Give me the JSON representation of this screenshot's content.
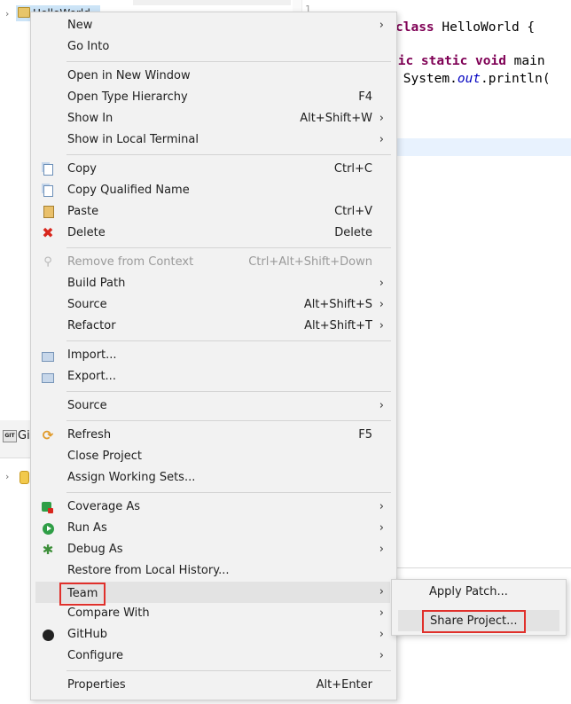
{
  "explorer": {
    "project_label": "HelloWorld"
  },
  "editor": {
    "line_number": "1",
    "code": {
      "line1_kw": "class",
      "line1_rest": " HelloWorld {",
      "line2_kw": "lic static void",
      "line2_rest": " main",
      "line3_pre": " System.",
      "line3_field": "out",
      "line3_post": ".println("
    }
  },
  "git_panel": {
    "tab_label": "Gi"
  },
  "context_menu": {
    "items": [
      {
        "label": "New",
        "shortcut": "",
        "submenu": true
      },
      {
        "label": "Go Into",
        "shortcut": ""
      },
      {
        "label": "Open in New Window",
        "shortcut": ""
      },
      {
        "label": "Open Type Hierarchy",
        "shortcut": "F4"
      },
      {
        "label": "Show In",
        "shortcut": "Alt+Shift+W",
        "submenu": true
      },
      {
        "label": "Show in Local Terminal",
        "shortcut": "",
        "submenu": true
      },
      {
        "label": "Copy",
        "shortcut": "Ctrl+C",
        "icon": "copy-icon"
      },
      {
        "label": "Copy Qualified Name",
        "shortcut": "",
        "icon": "copy-qualified-name-icon"
      },
      {
        "label": "Paste",
        "shortcut": "Ctrl+V",
        "icon": "paste-icon"
      },
      {
        "label": "Delete",
        "shortcut": "Delete",
        "icon": "delete-icon"
      },
      {
        "label": "Remove from Context",
        "shortcut": "Ctrl+Alt+Shift+Down",
        "disabled": true,
        "icon": "remove-context-icon"
      },
      {
        "label": "Build Path",
        "shortcut": "",
        "submenu": true
      },
      {
        "label": "Source",
        "shortcut": "Alt+Shift+S",
        "submenu": true
      },
      {
        "label": "Refactor",
        "shortcut": "Alt+Shift+T",
        "submenu": true
      },
      {
        "label": "Import...",
        "shortcut": "",
        "icon": "import-icon"
      },
      {
        "label": "Export...",
        "shortcut": "",
        "icon": "export-icon"
      },
      {
        "label": "Source",
        "shortcut": "",
        "submenu": true
      },
      {
        "label": "Refresh",
        "shortcut": "F5",
        "icon": "refresh-icon"
      },
      {
        "label": "Close Project",
        "shortcut": ""
      },
      {
        "label": "Assign Working Sets...",
        "shortcut": ""
      },
      {
        "label": "Coverage As",
        "shortcut": "",
        "submenu": true,
        "icon": "coverage-icon"
      },
      {
        "label": "Run As",
        "shortcut": "",
        "submenu": true,
        "icon": "run-icon"
      },
      {
        "label": "Debug As",
        "shortcut": "",
        "submenu": true,
        "icon": "debug-icon"
      },
      {
        "label": "Restore from Local History...",
        "shortcut": ""
      },
      {
        "label": "Team",
        "shortcut": "",
        "submenu": true,
        "highlighted": true
      },
      {
        "label": "Compare With",
        "shortcut": "",
        "submenu": true
      },
      {
        "label": "GitHub",
        "shortcut": "",
        "submenu": true,
        "icon": "github-icon"
      },
      {
        "label": "Configure",
        "shortcut": "",
        "submenu": true
      },
      {
        "label": "Properties",
        "shortcut": "Alt+Enter"
      }
    ],
    "arrow_glyph": "›"
  },
  "team_submenu": {
    "items": [
      {
        "label": "Apply Patch..."
      },
      {
        "label": "Share Project...",
        "highlighted": true
      }
    ]
  },
  "colors": {
    "menu_bg": "#f2f2f2",
    "hover_bg": "#e3e3e3",
    "highlight_box": "#e0302b",
    "keyword": "#7f0055",
    "selection": "#cce4f7"
  }
}
